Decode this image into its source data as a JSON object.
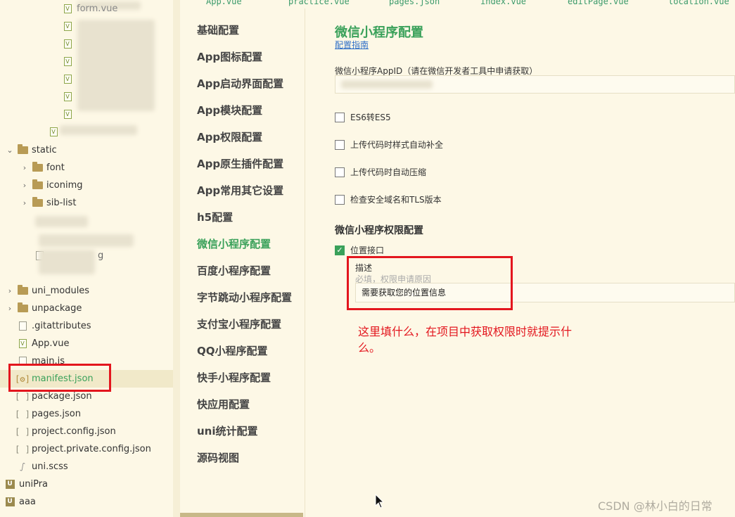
{
  "tabs": [
    "App.vue",
    "practice.vue",
    "pages.json",
    "index.vue",
    "editPage.vue",
    "location.vue"
  ],
  "tree": {
    "top_partial": "form.vue",
    "static": "static",
    "static_children": [
      "font",
      "iconimg",
      "sib-list"
    ],
    "blurred_partial": "g",
    "items": [
      {
        "label": "uni_modules",
        "type": "folder"
      },
      {
        "label": "unpackage",
        "type": "folder"
      },
      {
        "label": ".gitattributes",
        "type": "file"
      },
      {
        "label": "App.vue",
        "type": "vue"
      },
      {
        "label": "main.js",
        "type": "file"
      },
      {
        "label": "manifest.json",
        "type": "manifest"
      },
      {
        "label": "package.json",
        "type": "json"
      },
      {
        "label": "pages.json",
        "type": "json"
      },
      {
        "label": "project.config.json",
        "type": "json"
      },
      {
        "label": "project.private.config.json",
        "type": "json"
      },
      {
        "label": "uni.scss",
        "type": "scss"
      },
      {
        "label": "uniPra",
        "type": "project"
      },
      {
        "label": "aaa",
        "type": "project"
      }
    ]
  },
  "nav": {
    "items": [
      "基础配置",
      "App图标配置",
      "App启动界面配置",
      "App模块配置",
      "App权限配置",
      "App原生插件配置",
      "App常用其它设置",
      "h5配置",
      "微信小程序配置",
      "百度小程序配置",
      "字节跳动小程序配置",
      "支付宝小程序配置",
      "QQ小程序配置",
      "快手小程序配置",
      "快应用配置",
      "uni统计配置",
      "源码视图"
    ],
    "active_index": 8
  },
  "main": {
    "title": "微信小程序配置",
    "guide_link": "配置指南",
    "appid_label": "微信小程序AppID（请在微信开发者工具中申请获取）",
    "checks": [
      {
        "label": "ES6转ES5",
        "checked": false
      },
      {
        "label": "上传代码时样式自动补全",
        "checked": false
      },
      {
        "label": "上传代码时自动压缩",
        "checked": false
      },
      {
        "label": "检查安全域名和TLS版本",
        "checked": false
      }
    ],
    "perm_title": "微信小程序权限配置",
    "location_check": {
      "label": "位置接口",
      "checked": true
    },
    "desc_label": "描述",
    "desc_hint": "必填，权限申请原因",
    "desc_value": "需要获取您的位置信息",
    "annotation": "这里填什么，在项目中获取权限时就提示什么。"
  },
  "watermark": "CSDN @林小白的日常",
  "colors": {
    "accent": "#3aa15a",
    "annotation": "#e3161e",
    "link": "#2f6fc7"
  }
}
